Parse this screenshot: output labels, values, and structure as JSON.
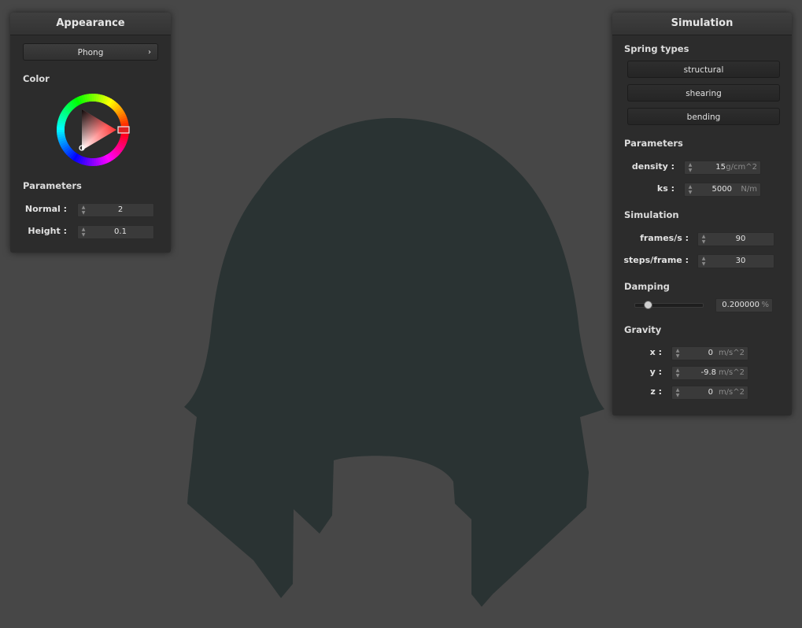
{
  "colors": {
    "background": "#474747",
    "cloth": "#2a3333",
    "selected_hue": "#ff0000"
  },
  "appearance": {
    "title": "Appearance",
    "shader": "Phong",
    "color_label": "Color",
    "parameters_label": "Parameters",
    "normal_label": "Normal :",
    "normal_value": "2",
    "height_label": "Height :",
    "height_value": "0.1"
  },
  "simulation_panel": {
    "title": "Simulation",
    "spring_types_label": "Spring types",
    "spring_buttons": [
      "structural",
      "shearing",
      "bending"
    ],
    "parameters_label": "Parameters",
    "density_label": "density :",
    "density_value": "15",
    "density_unit": "g/cm^2",
    "ks_label": "ks :",
    "ks_value": "5000",
    "ks_unit": "N/m",
    "simulation_label": "Simulation",
    "fps_label": "frames/s :",
    "fps_value": "90",
    "steps_label": "steps/frame :",
    "steps_value": "30",
    "damping_label": "Damping",
    "damping_value": "0.200000",
    "damping_unit": "%",
    "damping_fraction": 0.2,
    "gravity_label": "Gravity",
    "gx_label": "x :",
    "gx_value": "0",
    "gy_label": "y :",
    "gy_value": "-9.8",
    "gz_label": "z :",
    "gz_value": "0",
    "gravity_unit": "m/s^2"
  }
}
